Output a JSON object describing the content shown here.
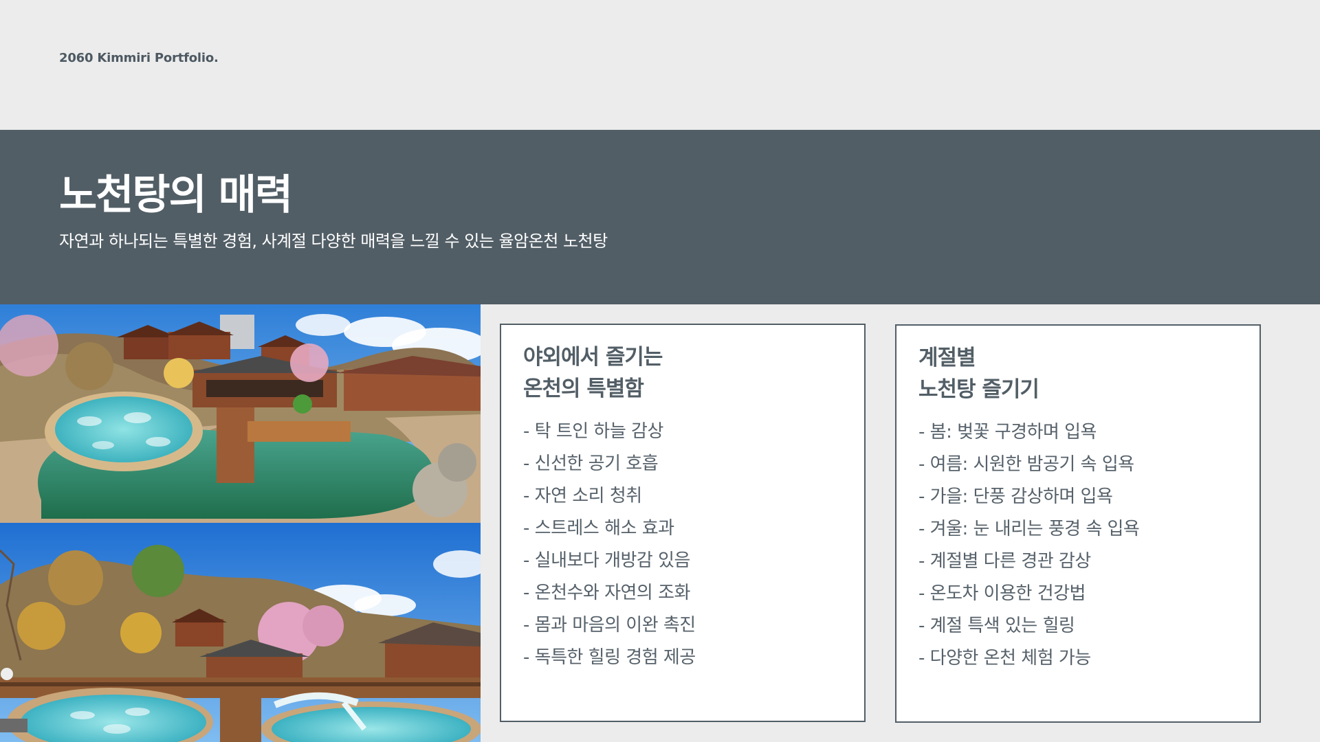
{
  "header": {
    "portfolio_label": "2060 Kimmiri Portfolio."
  },
  "banner": {
    "title": "노천탕의 매력",
    "subtitle": "자연과 하나되는 특별한 경험, 사계절 다양한 매력을 느낄 수 있는 율암온천 노천탕"
  },
  "colors": {
    "background": "#ececec",
    "banner": "#525e66",
    "card_border": "#525e66",
    "text_dark": "#56616a"
  },
  "cards": [
    {
      "heading_line1": "야외에서 즐기는",
      "heading_line2": "온천의 특별함",
      "items": [
        "- 탁 트인 하늘 감상",
        "- 신선한 공기 호흡",
        "- 자연 소리 청취",
        "- 스트레스 해소 효과",
        "- 실내보다 개방감 있음",
        "- 온천수와 자연의 조화",
        "- 몸과 마음의 이완 촉진",
        "- 독특한 힐링 경험 제공"
      ]
    },
    {
      "heading_line1": "계절별",
      "heading_line2": "노천탕 즐기기",
      "items": [
        "- 봄: 벚꽃 구경하며 입욕",
        "- 여름: 시원한 밤공기 속 입욕",
        "- 가을: 단풍 감상하며 입욕",
        "- 겨울: 눈 내리는 풍경 속 입욕",
        "- 계절별 다른 경관 감상",
        "- 온도차 이용한 건강법",
        "- 계절 특색 있는 힐링",
        "- 다양한 온천 체험 가능"
      ]
    }
  ]
}
